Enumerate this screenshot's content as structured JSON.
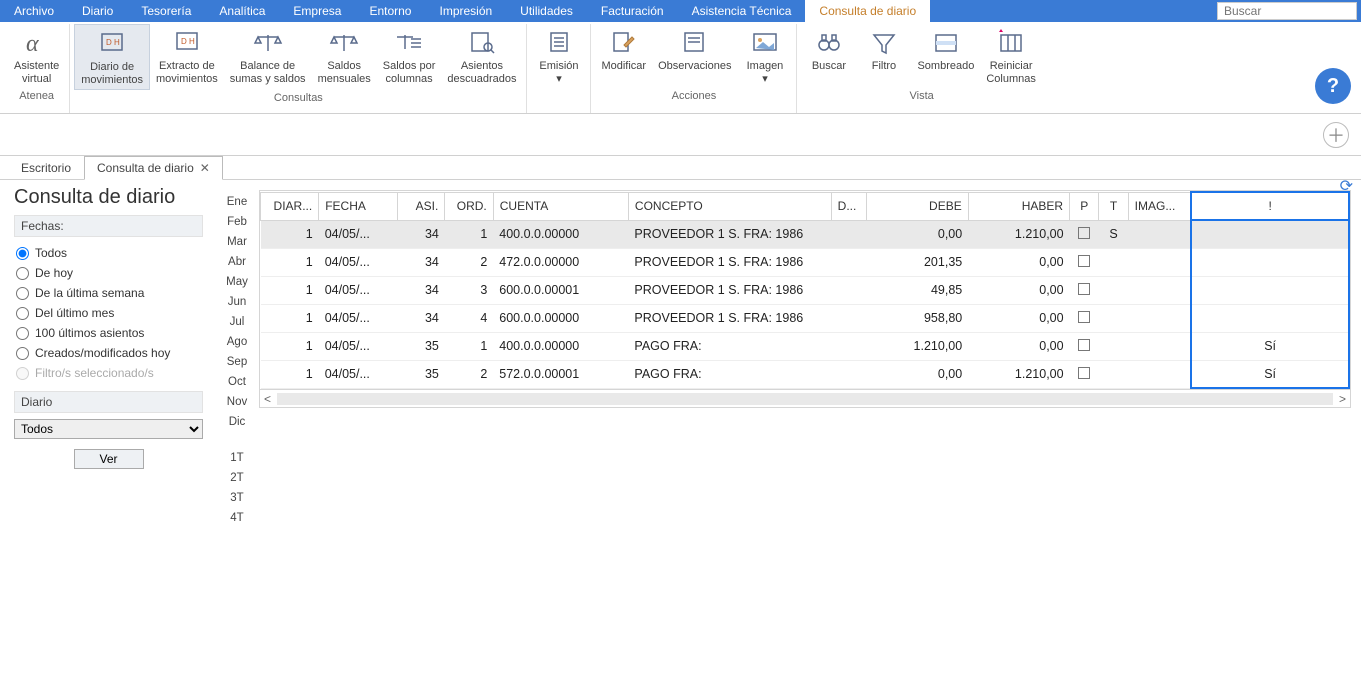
{
  "menu": {
    "items": [
      "Archivo",
      "Diario",
      "Tesorería",
      "Analítica",
      "Empresa",
      "Entorno",
      "Impresión",
      "Utilidades",
      "Facturación",
      "Asistencia Técnica",
      "Consulta de diario"
    ],
    "active_index": 10,
    "search_placeholder": "Buscar"
  },
  "ribbon": {
    "groups": [
      {
        "label": "Atenea",
        "buttons": [
          {
            "name": "asistente-virtual",
            "label": "Asistente\nvirtual",
            "icon": "alpha"
          }
        ]
      },
      {
        "label": "Consultas",
        "buttons": [
          {
            "name": "diario-movimientos",
            "label": "Diario de\nmovimientos",
            "icon": "doc-dh",
            "active": true
          },
          {
            "name": "extracto-movimientos",
            "label": "Extracto de\nmovimientos",
            "icon": "doc-dh"
          },
          {
            "name": "balance-sumas-saldos",
            "label": "Balance de\nsumas y saldos",
            "icon": "scales"
          },
          {
            "name": "saldos-mensuales",
            "label": "Saldos\nmensuales",
            "icon": "scales"
          },
          {
            "name": "saldos-columnas",
            "label": "Saldos por\ncolumnas",
            "icon": "scales-lines"
          },
          {
            "name": "asientos-descuadrados",
            "label": "Asientos\ndescuadrados",
            "icon": "doc-search"
          }
        ]
      },
      {
        "label": "",
        "buttons": [
          {
            "name": "emision",
            "label": "Emisión\n▾",
            "icon": "doc"
          }
        ]
      },
      {
        "label": "Acciones",
        "buttons": [
          {
            "name": "modificar",
            "label": "Modificar",
            "icon": "edit"
          },
          {
            "name": "observaciones",
            "label": "Observaciones",
            "icon": "note"
          },
          {
            "name": "imagen",
            "label": "Imagen\n▾",
            "icon": "image"
          }
        ]
      },
      {
        "label": "Vista",
        "buttons": [
          {
            "name": "buscar",
            "label": "Buscar",
            "icon": "binoculars"
          },
          {
            "name": "filtro",
            "label": "Filtro",
            "icon": "funnel"
          },
          {
            "name": "sombreado",
            "label": "Sombreado",
            "icon": "shade"
          },
          {
            "name": "reiniciar-columnas",
            "label": "Reiniciar\nColumnas",
            "icon": "cols"
          }
        ]
      }
    ]
  },
  "tabs": {
    "items": [
      {
        "label": "Escritorio",
        "closable": false
      },
      {
        "label": "Consulta de diario",
        "closable": true
      }
    ],
    "active_index": 1
  },
  "page_title": "Consulta de diario",
  "filters": {
    "section1": "Fechas:",
    "radios": [
      {
        "label": "Todos",
        "checked": true
      },
      {
        "label": "De hoy",
        "checked": false
      },
      {
        "label": "De la última semana",
        "checked": false
      },
      {
        "label": "Del último mes",
        "checked": false
      },
      {
        "label": "100 últimos asientos",
        "checked": false
      },
      {
        "label": "Creados/modificados hoy",
        "checked": false
      },
      {
        "label": "Filtro/s seleccionado/s",
        "checked": false,
        "disabled": true
      }
    ],
    "section2": "Diario",
    "diario_select": "Todos",
    "ver_btn": "Ver"
  },
  "months": [
    "Ene",
    "Feb",
    "Mar",
    "Abr",
    "May",
    "Jun",
    "Jul",
    "Ago",
    "Sep",
    "Oct",
    "Nov",
    "Dic",
    "",
    "1T",
    "2T",
    "3T",
    "4T"
  ],
  "grid": {
    "columns": [
      "DIAR...",
      "FECHA",
      "ASI.",
      "ORD.",
      "CUENTA",
      "CONCEPTO",
      "D...",
      "DEBE",
      "HABER",
      "P",
      "T",
      "IMAG...",
      "!"
    ],
    "rows": [
      {
        "diar": "1",
        "fecha": "04/05/...",
        "asi": "34",
        "ord": "1",
        "cuenta": "400.0.0.00000",
        "concepto": "PROVEEDOR 1 S. FRA:  1986",
        "d": "",
        "debe": "0,00",
        "haber": "1.210,00",
        "p": "",
        "t": "S",
        "imag": "",
        "bang": "",
        "sel": true
      },
      {
        "diar": "1",
        "fecha": "04/05/...",
        "asi": "34",
        "ord": "2",
        "cuenta": "472.0.0.00000",
        "concepto": "PROVEEDOR 1 S. FRA:  1986",
        "d": "",
        "debe": "201,35",
        "haber": "0,00",
        "p": "",
        "t": "",
        "imag": "",
        "bang": ""
      },
      {
        "diar": "1",
        "fecha": "04/05/...",
        "asi": "34",
        "ord": "3",
        "cuenta": "600.0.0.00001",
        "concepto": "PROVEEDOR 1 S. FRA:  1986",
        "d": "",
        "debe": "49,85",
        "haber": "0,00",
        "p": "",
        "t": "",
        "imag": "",
        "bang": ""
      },
      {
        "diar": "1",
        "fecha": "04/05/...",
        "asi": "34",
        "ord": "4",
        "cuenta": "600.0.0.00000",
        "concepto": "PROVEEDOR 1 S. FRA:  1986",
        "d": "",
        "debe": "958,80",
        "haber": "0,00",
        "p": "",
        "t": "",
        "imag": "",
        "bang": ""
      },
      {
        "diar": "1",
        "fecha": "04/05/...",
        "asi": "35",
        "ord": "1",
        "cuenta": "400.0.0.00000",
        "concepto": "PAGO FRA:",
        "d": "",
        "debe": "1.210,00",
        "haber": "0,00",
        "p": "",
        "t": "",
        "imag": "",
        "bang": "Sí"
      },
      {
        "diar": "1",
        "fecha": "04/05/...",
        "asi": "35",
        "ord": "2",
        "cuenta": "572.0.0.00001",
        "concepto": "PAGO FRA:",
        "d": "",
        "debe": "0,00",
        "haber": "1.210,00",
        "p": "",
        "t": "",
        "imag": "",
        "bang": "Sí"
      }
    ]
  }
}
